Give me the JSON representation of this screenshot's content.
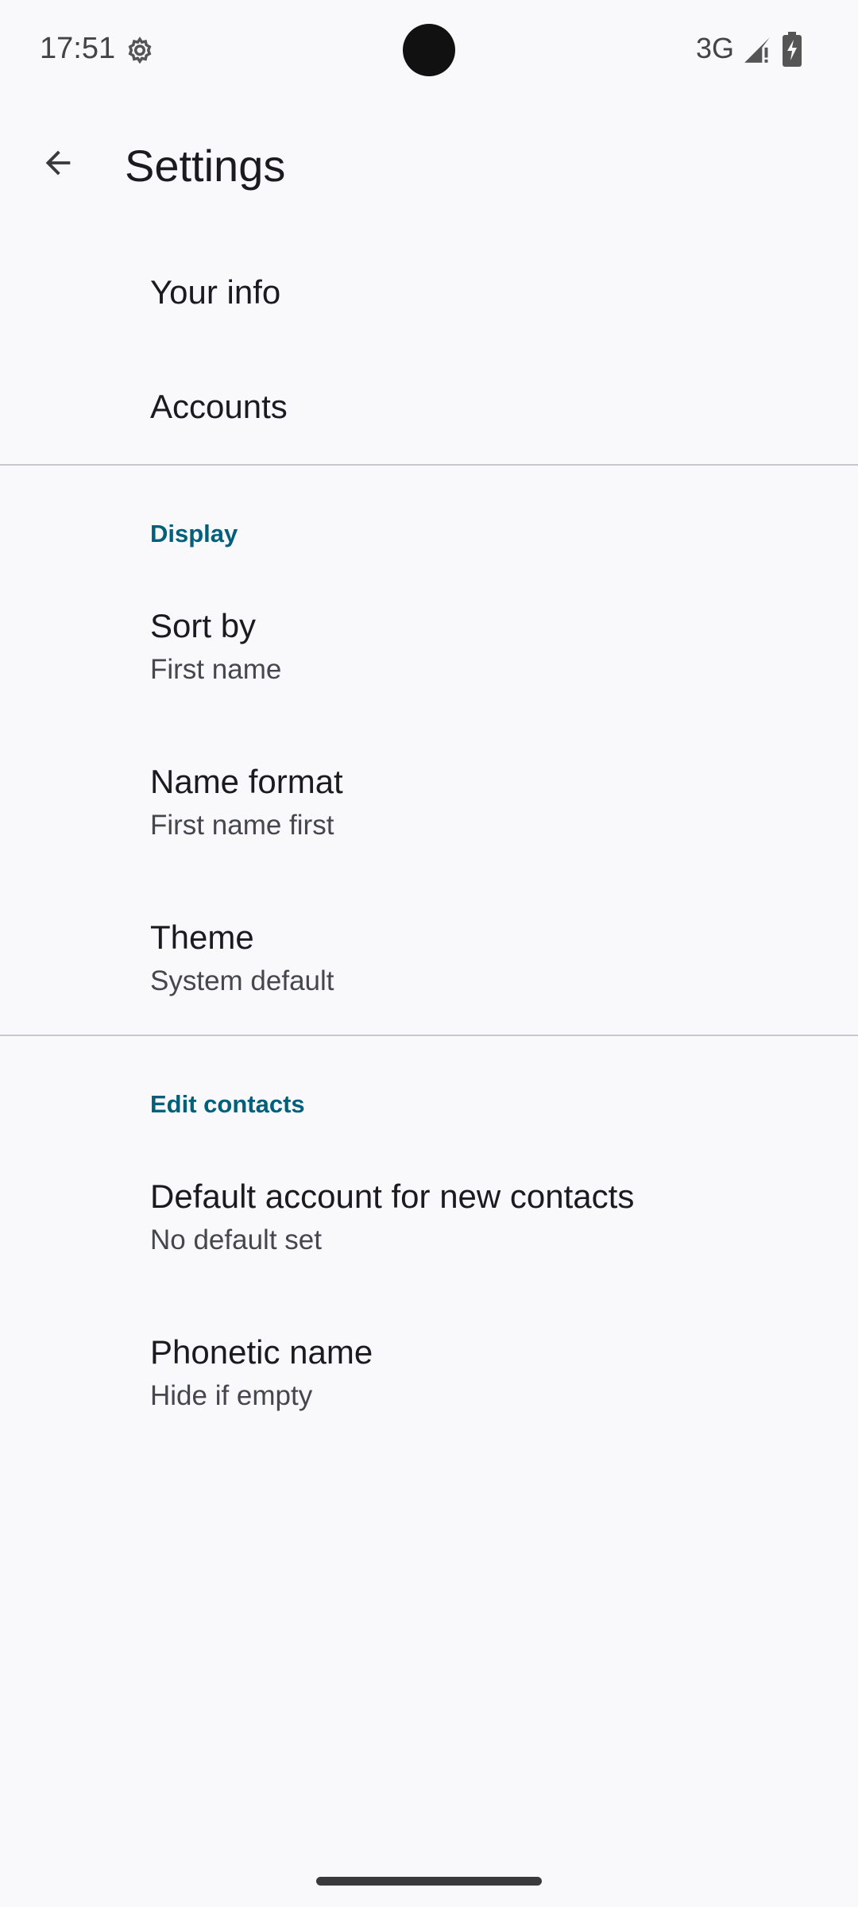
{
  "status_bar": {
    "time": "17:51",
    "network": "3G",
    "icons": [
      "gear-icon",
      "signal-icon",
      "battery-charging-icon"
    ]
  },
  "app_bar": {
    "title": "Settings",
    "back_icon": "arrow-back-icon"
  },
  "items_top": [
    {
      "title": "Your info"
    },
    {
      "title": "Accounts"
    }
  ],
  "display_section": {
    "header": "Display",
    "items": [
      {
        "title": "Sort by",
        "subtitle": "First name"
      },
      {
        "title": "Name format",
        "subtitle": "First name first"
      },
      {
        "title": "Theme",
        "subtitle": "System default"
      }
    ]
  },
  "edit_section": {
    "header": "Edit contacts",
    "items": [
      {
        "title": "Default account for new contacts",
        "subtitle": "No default set"
      },
      {
        "title": "Phonetic name",
        "subtitle": "Hide if empty"
      }
    ]
  },
  "colors": {
    "background": "#f9f9fc",
    "section_header": "#005f7a",
    "divider": "#c8c8cc"
  }
}
